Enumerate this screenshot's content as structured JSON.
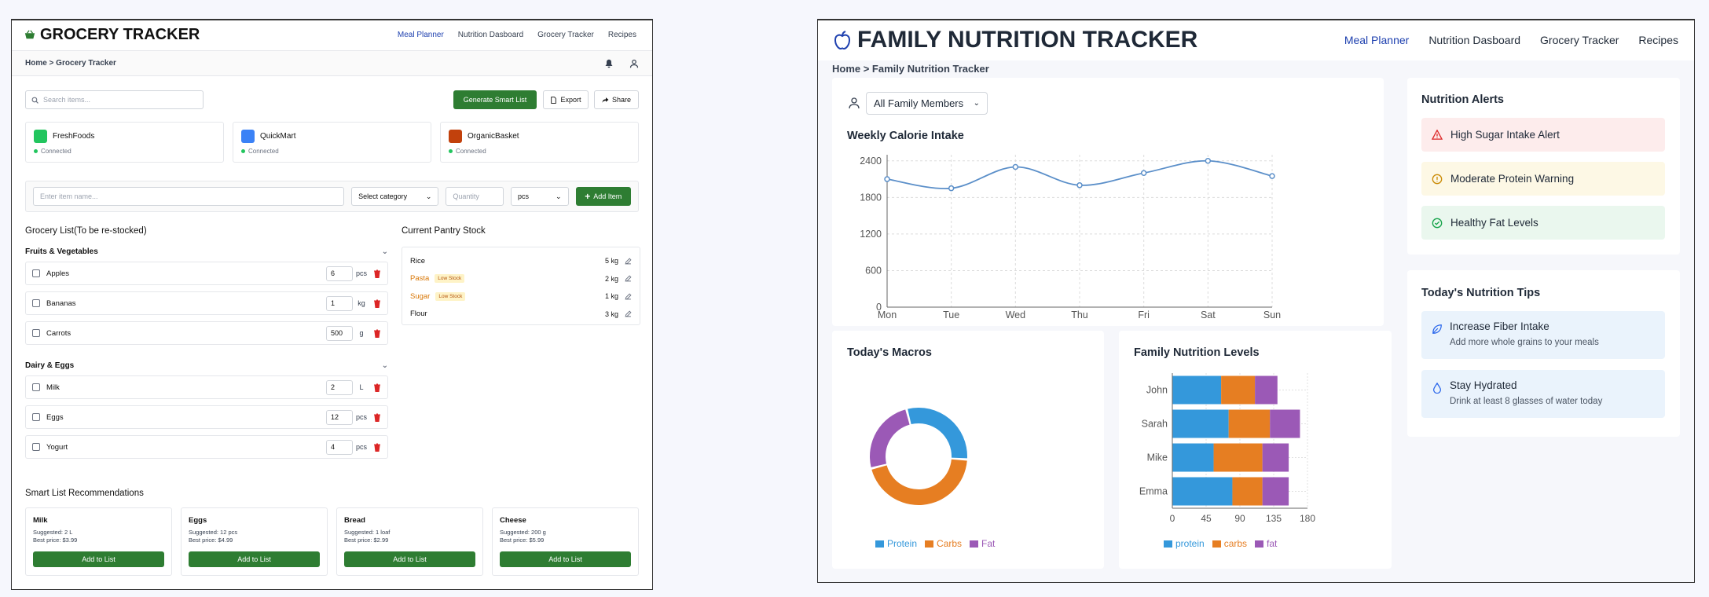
{
  "grocery": {
    "title": "GROCERY TRACKER",
    "nav": [
      "Meal Planner",
      "Nutrition Dasboard",
      "Grocery Tracker",
      "Recipes"
    ],
    "breadcrumb": "Home > Grocery Tracker",
    "search_placeholder": "Search items...",
    "generate_label": "Generate Smart List",
    "export_label": "Export",
    "share_label": "Share",
    "stores": [
      {
        "name": "FreshFoods",
        "status": "Connected",
        "color": "#22c55e"
      },
      {
        "name": "QuickMart",
        "status": "Connected",
        "color": "#3b82f6"
      },
      {
        "name": "OrganicBasket",
        "status": "Connected",
        "color": "#c2410c"
      }
    ],
    "add_form": {
      "item_placeholder": "Enter item name...",
      "category": "Select category",
      "quantity_placeholder": "Quantity",
      "unit": "pcs",
      "add_label": "Add Item"
    },
    "list_title": "Grocery List(To be re-stocked)",
    "categories": [
      {
        "name": "Fruits & Vegetables",
        "items": [
          {
            "name": "Apples",
            "qty": "6",
            "unit": "pcs"
          },
          {
            "name": "Bananas",
            "qty": "1",
            "unit": "kg"
          },
          {
            "name": "Carrots",
            "qty": "500",
            "unit": "g"
          }
        ]
      },
      {
        "name": "Dairy & Eggs",
        "items": [
          {
            "name": "Milk",
            "qty": "2",
            "unit": "L"
          },
          {
            "name": "Eggs",
            "qty": "12",
            "unit": "pcs"
          },
          {
            "name": "Yogurt",
            "qty": "4",
            "unit": "pcs"
          }
        ]
      }
    ],
    "pantry_title": "Current Pantry Stock",
    "pantry": [
      {
        "name": "Rice",
        "qty": "5 kg",
        "badge": ""
      },
      {
        "name": "Pasta",
        "qty": "2 kg",
        "badge": "Low Stock"
      },
      {
        "name": "Sugar",
        "qty": "1 kg",
        "badge": "Low Stock"
      },
      {
        "name": "Flour",
        "qty": "3 kg",
        "badge": ""
      }
    ],
    "recs_title": "Smart List Recommendations",
    "recommendations": [
      {
        "name": "Milk",
        "suggested": "Suggested: 2 L",
        "price": "Best price: $3.99",
        "button": "Add to List"
      },
      {
        "name": "Eggs",
        "suggested": "Suggested: 12 pcs",
        "price": "Best price: $4.99",
        "button": "Add to List"
      },
      {
        "name": "Bread",
        "suggested": "Suggested: 1 loaf",
        "price": "Best price: $2.99",
        "button": "Add to List"
      },
      {
        "name": "Cheese",
        "suggested": "Suggested: 200 g",
        "price": "Best price: $5.99",
        "button": "Add to List"
      }
    ]
  },
  "nutrition": {
    "title": "FAMILY NUTRITION TRACKER",
    "nav": [
      "Meal Planner",
      "Nutrition Dasboard",
      "Grocery Tracker",
      "Recipes"
    ],
    "breadcrumb": "Home > Family Nutrition Tracker",
    "member_select": "All Family Members",
    "alerts_title": "Nutrition Alerts",
    "alerts": [
      {
        "text": "High Sugar Intake Alert",
        "level": "danger",
        "bg": "#fdecec",
        "fg": "#dc2626"
      },
      {
        "text": "Moderate Protein Warning",
        "level": "warning",
        "bg": "#fdf8e5",
        "fg": "#ca8a04"
      },
      {
        "text": "Healthy Fat Levels",
        "level": "success",
        "bg": "#eaf7ee",
        "fg": "#16a34a"
      }
    ],
    "tips_title": "Today's Nutrition Tips",
    "tips": [
      {
        "title": "Increase Fiber Intake",
        "desc": "Add more whole grains to your meals"
      },
      {
        "title": "Stay Hydrated",
        "desc": "Drink at least 8 glasses of water today"
      }
    ]
  },
  "chart_data": [
    {
      "type": "line",
      "title": "Weekly Calorie Intake",
      "categories": [
        "Mon",
        "Tue",
        "Wed",
        "Thu",
        "Fri",
        "Sat",
        "Sun"
      ],
      "values": [
        2100,
        1950,
        2300,
        2000,
        2200,
        2400,
        2150
      ],
      "yticks": [
        0,
        600,
        1200,
        1800,
        2400
      ],
      "ylim": [
        0,
        2500
      ],
      "grid": true,
      "color": "#5b8fc9"
    },
    {
      "type": "pie",
      "title": "Today's Macros",
      "categories": [
        "Protein",
        "Carbs",
        "Fat"
      ],
      "values": [
        30,
        45,
        25
      ],
      "colors": [
        "#3498db",
        "#e67e22",
        "#9b59b6"
      ],
      "legend": "bottom"
    },
    {
      "type": "bar",
      "title": "Family Nutrition Levels",
      "orientation": "horizontal",
      "stacked": true,
      "categories": [
        "John",
        "Sarah",
        "Mike",
        "Emma"
      ],
      "series": [
        {
          "name": "protein",
          "values": [
            65,
            75,
            55,
            80
          ],
          "color": "#3498db"
        },
        {
          "name": "carbs",
          "values": [
            45,
            55,
            65,
            40
          ],
          "color": "#e67e22"
        },
        {
          "name": "fat",
          "values": [
            30,
            40,
            35,
            35
          ],
          "color": "#9b59b6"
        }
      ],
      "xticks": [
        0,
        45,
        90,
        135,
        180
      ],
      "xlim": [
        0,
        180
      ],
      "legend": "bottom"
    }
  ]
}
